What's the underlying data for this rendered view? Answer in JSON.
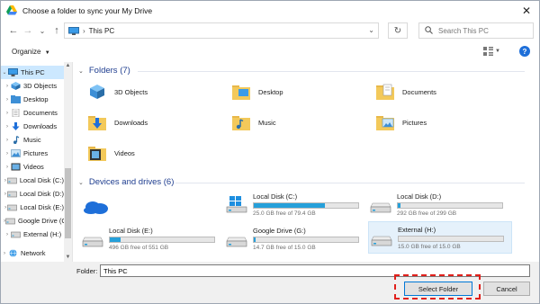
{
  "window": {
    "title": "Choose a folder to sync your My Drive",
    "close_symbol": "✕"
  },
  "nav": {
    "back_symbol": "←",
    "forward_symbol": "→",
    "recent_symbol": "⌄",
    "up_symbol": "↑",
    "address_separator": "›",
    "address_crumb": "This PC",
    "address_dropdown_symbol": "⌄",
    "refresh_symbol": "↻",
    "search_placeholder": "Search This PC",
    "search_icon": "search-icon"
  },
  "toolbar": {
    "organize_label": "Organize",
    "dropdown_symbol": "▼",
    "help_symbol": "?"
  },
  "sidebar": {
    "items": [
      {
        "label": "This PC",
        "icon": "pc-icon",
        "expanded": true
      },
      {
        "label": "3D Objects",
        "icon": "3d-objects-icon"
      },
      {
        "label": "Desktop",
        "icon": "folder-blue-icon"
      },
      {
        "label": "Documents",
        "icon": "documents-icon"
      },
      {
        "label": "Downloads",
        "icon": "download-icon"
      },
      {
        "label": "Music",
        "icon": "music-icon"
      },
      {
        "label": "Pictures",
        "icon": "pictures-icon"
      },
      {
        "label": "Videos",
        "icon": "videos-icon"
      },
      {
        "label": "Local Disk (C:)",
        "icon": "drive-icon"
      },
      {
        "label": "Local Disk (D:)",
        "icon": "drive-icon"
      },
      {
        "label": "Local Disk (E:)",
        "icon": "drive-icon"
      },
      {
        "label": "Google Drive (G:)",
        "icon": "drive-icon"
      },
      {
        "label": "External (H:)",
        "icon": "drive-icon"
      },
      {
        "label": "Network",
        "icon": "network-icon"
      }
    ]
  },
  "folders": {
    "header": "Folders (7)",
    "items": [
      {
        "label": "3D Objects",
        "icon": "3d-objects-folder-icon"
      },
      {
        "label": "Desktop",
        "icon": "desktop-folder-icon"
      },
      {
        "label": "Documents",
        "icon": "documents-folder-icon"
      },
      {
        "label": "Downloads",
        "icon": "downloads-folder-icon"
      },
      {
        "label": "Music",
        "icon": "music-folder-icon"
      },
      {
        "label": "Pictures",
        "icon": "pictures-folder-icon"
      },
      {
        "label": "Videos",
        "icon": "videos-folder-icon"
      }
    ]
  },
  "drives": {
    "header": "Devices and drives (6)",
    "items": [
      {
        "label": "",
        "icon": "onedrive-cloud-icon"
      },
      {
        "label": "Local Disk (C:)",
        "free": "25.0 GB free of 79.4 GB",
        "used_fraction": 0.685,
        "icon": "windows-drive-icon"
      },
      {
        "label": "Local Disk (D:)",
        "free": "292 GB free of 299 GB",
        "used_fraction": 0.023,
        "icon": "drive-icon"
      },
      {
        "label": "Local Disk (E:)",
        "free": "496 GB free of 551 GB",
        "used_fraction": 0.1,
        "icon": "drive-icon"
      },
      {
        "label": "Google Drive (G:)",
        "free": "14.7 GB free of 15.0 GB",
        "used_fraction": 0.02,
        "icon": "drive-icon"
      },
      {
        "label": "External (H:)",
        "free": "15.0 GB free of 15.0 GB",
        "used_fraction": 0.0,
        "icon": "drive-icon"
      }
    ]
  },
  "footer": {
    "folder_label": "Folder:",
    "folder_value": "This PC",
    "select_label": "Select Folder",
    "cancel_label": "Cancel"
  },
  "colors": {
    "accent": "#0078d7",
    "highlight_dashed": "#e0201b",
    "drive_fill": "#26a0da",
    "header_text": "#1e3d8f",
    "selection": "#cce8ff"
  }
}
